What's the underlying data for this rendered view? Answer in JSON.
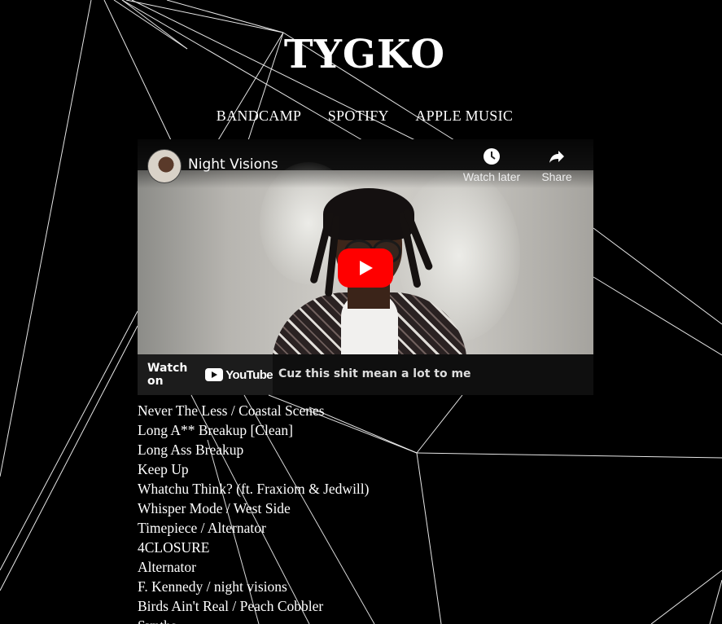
{
  "site": {
    "title": "TYGKO"
  },
  "nav": {
    "links": [
      {
        "label": "BANDCAMP"
      },
      {
        "label": "SPOTIFY"
      },
      {
        "label": "APPLE MUSIC"
      }
    ]
  },
  "video": {
    "title": "Night Visions",
    "watch_later_label": "Watch later",
    "share_label": "Share",
    "watch_on_label": "Watch on",
    "youtube_label": "YouTube",
    "caption": "Cuz this shit mean a lot to me",
    "play_color": "#ff0000"
  },
  "tracks": [
    "Never The Less / Coastal Scenes",
    "Long A** Breakup [Clean]",
    "Long Ass Breakup",
    "Keep Up",
    "Whatchu Think? (ft. Fraxiom & Jedwill)",
    "Whisper Mode / West Side",
    "Timepiece / Alternator",
    "4CLOSURE",
    "Alternator",
    "F. Kennedy / night visions",
    "Birds Ain't Real / Peach Cobbler",
    "Synths"
  ],
  "colors": {
    "background": "#000000",
    "text": "#ffffff",
    "line": "#ffffff"
  }
}
